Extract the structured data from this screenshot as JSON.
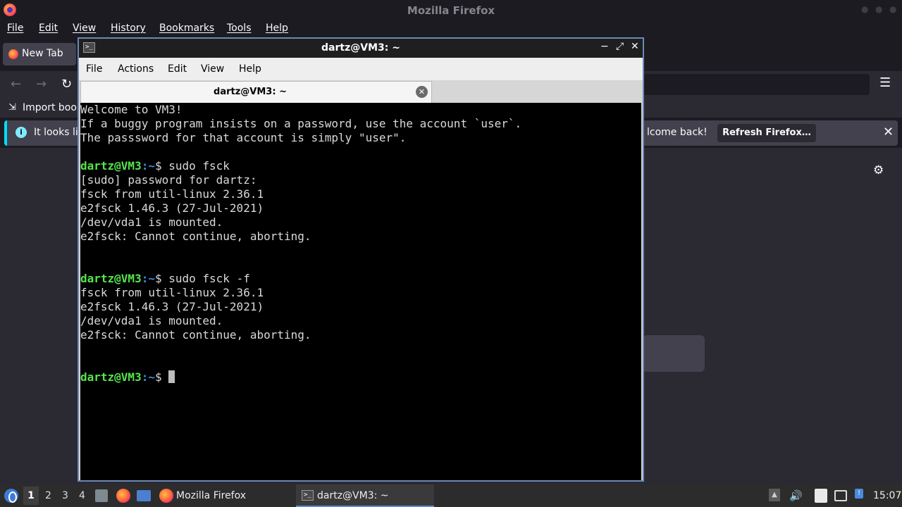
{
  "firefox": {
    "window_title": "Mozilla Firefox",
    "menu": [
      "File",
      "Edit",
      "View",
      "History",
      "Bookmarks",
      "Tools",
      "Help"
    ],
    "tab_label": "New Tab",
    "import_bookmarks_label": "Import book",
    "notice": {
      "text": "It looks lik",
      "welcome_text": "lcome back!",
      "refresh_button": "Refresh Firefox…"
    },
    "icons": [
      "back-arrow-icon",
      "forward-arrow-icon",
      "reload-icon",
      "hamburger-menu-icon",
      "info-icon",
      "close-icon",
      "gear-icon"
    ]
  },
  "terminal": {
    "window_title": "dartz@VM3: ~",
    "menu": [
      "File",
      "Actions",
      "Edit",
      "View",
      "Help"
    ],
    "tab_label": "dartz@VM3: ~",
    "lines": [
      {
        "kind": "text",
        "text": "Welcome to VM3!"
      },
      {
        "kind": "text",
        "text": "If a buggy program insists on a password, use the account `user`."
      },
      {
        "kind": "text",
        "text": "The passsword for that account is simply \"user\"."
      },
      {
        "kind": "blank",
        "text": ""
      },
      {
        "kind": "prompt",
        "user": "dartz@VM3",
        "path": ":~",
        "cmd": "$ sudo fsck"
      },
      {
        "kind": "text",
        "text": "[sudo] password for dartz:"
      },
      {
        "kind": "text",
        "text": "fsck from util-linux 2.36.1"
      },
      {
        "kind": "text",
        "text": "e2fsck 1.46.3 (27-Jul-2021)"
      },
      {
        "kind": "text",
        "text": "/dev/vda1 is mounted."
      },
      {
        "kind": "text",
        "text": "e2fsck: Cannot continue, aborting."
      },
      {
        "kind": "blank",
        "text": ""
      },
      {
        "kind": "blank",
        "text": ""
      },
      {
        "kind": "prompt",
        "user": "dartz@VM3",
        "path": ":~",
        "cmd": "$ sudo fsck -f"
      },
      {
        "kind": "text",
        "text": "fsck from util-linux 2.36.1"
      },
      {
        "kind": "text",
        "text": "e2fsck 1.46.3 (27-Jul-2021)"
      },
      {
        "kind": "text",
        "text": "/dev/vda1 is mounted."
      },
      {
        "kind": "text",
        "text": "e2fsck: Cannot continue, aborting."
      },
      {
        "kind": "blank",
        "text": ""
      },
      {
        "kind": "blank",
        "text": ""
      },
      {
        "kind": "prompt",
        "user": "dartz@VM3",
        "path": ":~",
        "cmd": "$ ",
        "cursor": true
      }
    ],
    "colors": {
      "prompt_user": "#55e64b",
      "prompt_path": "#3e8ce0",
      "text": "#d9d9d9",
      "background": "#000000"
    }
  },
  "taskbar": {
    "workspaces": [
      "1",
      "2",
      "3",
      "4"
    ],
    "active_workspace": "1",
    "tasks": [
      {
        "label": "Mozilla Firefox",
        "icon": "firefox-icon"
      },
      {
        "label": "dartz@VM3: ~",
        "icon": "terminal-icon"
      }
    ],
    "clock": "15:07",
    "tray_icons": [
      "tray-expand-icon",
      "volume-icon",
      "clipboard-icon",
      "network-icon",
      "notification-icon"
    ]
  }
}
